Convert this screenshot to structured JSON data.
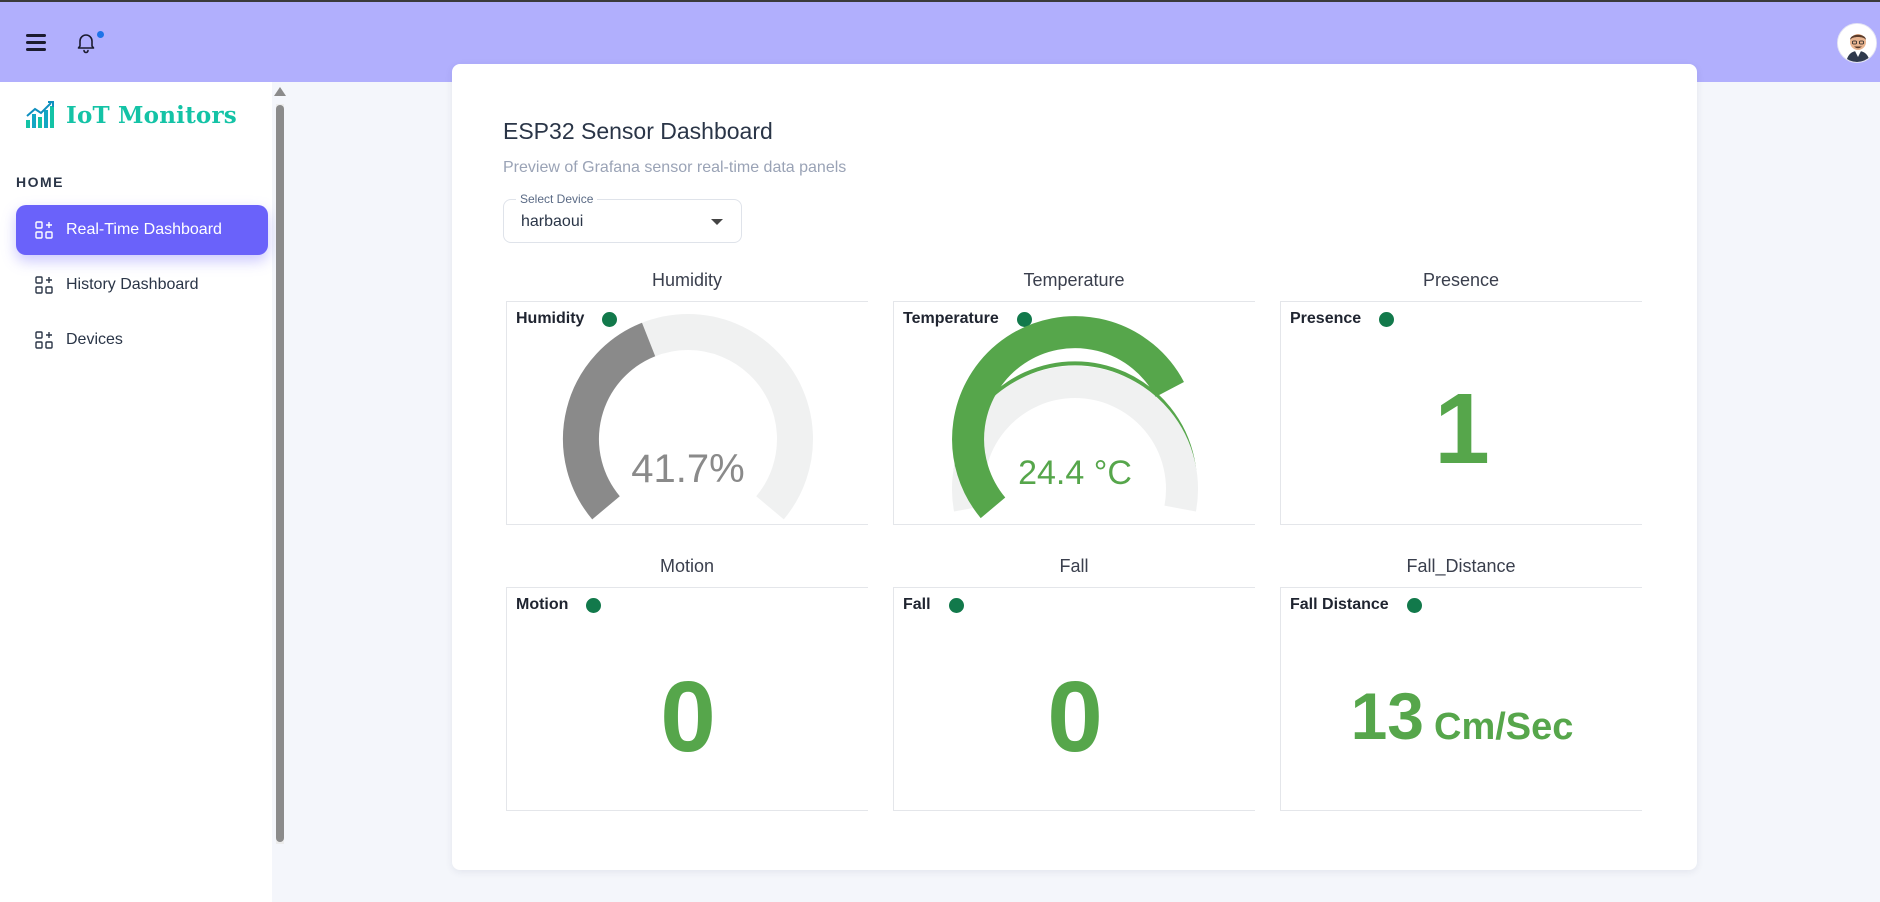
{
  "app": {
    "logo_text": "IoT Monitors"
  },
  "sidebar": {
    "section": "HOME",
    "items": [
      {
        "label": "Real-Time Dashboard",
        "icon": "grid-plus-icon",
        "active": true
      },
      {
        "label": "History Dashboard",
        "icon": "grid-plus-icon",
        "active": false
      },
      {
        "label": "Devices",
        "icon": "grid-plus-icon",
        "active": false
      }
    ]
  },
  "header": {
    "menu_icon": "hamburger-icon",
    "notification_icon": "bell-icon",
    "avatar_icon": "user-avatar"
  },
  "main": {
    "title": "ESP32 Sensor Dashboard",
    "subtitle": "Preview of Grafana sensor real-time data panels",
    "device_select": {
      "label": "Select Device",
      "value": "harbaoui"
    },
    "panels": [
      {
        "title": "Humidity",
        "label": "Humidity",
        "type": "gauge",
        "value": "41.7%",
        "fraction": 0.417,
        "color": "#8a8a8a"
      },
      {
        "title": "Temperature",
        "label": "Temperature",
        "type": "gauge",
        "value": "24.4 °C",
        "fraction": 0.74,
        "color": "#56a64b"
      },
      {
        "title": "Presence",
        "label": "Presence",
        "type": "stat",
        "value": "1",
        "unit": ""
      },
      {
        "title": "Motion",
        "label": "Motion",
        "type": "stat",
        "value": "0",
        "unit": ""
      },
      {
        "title": "Fall",
        "label": "Fall",
        "type": "stat",
        "value": "0",
        "unit": ""
      },
      {
        "title": "Fall_Distance",
        "label": "Fall Distance",
        "type": "stat",
        "value": "13",
        "unit": "Cm/Sec"
      }
    ]
  },
  "colors": {
    "topbar": "#b1affd",
    "accent": "#6a62fa",
    "status_ok": "#12794b",
    "value_green": "#56a64b"
  }
}
